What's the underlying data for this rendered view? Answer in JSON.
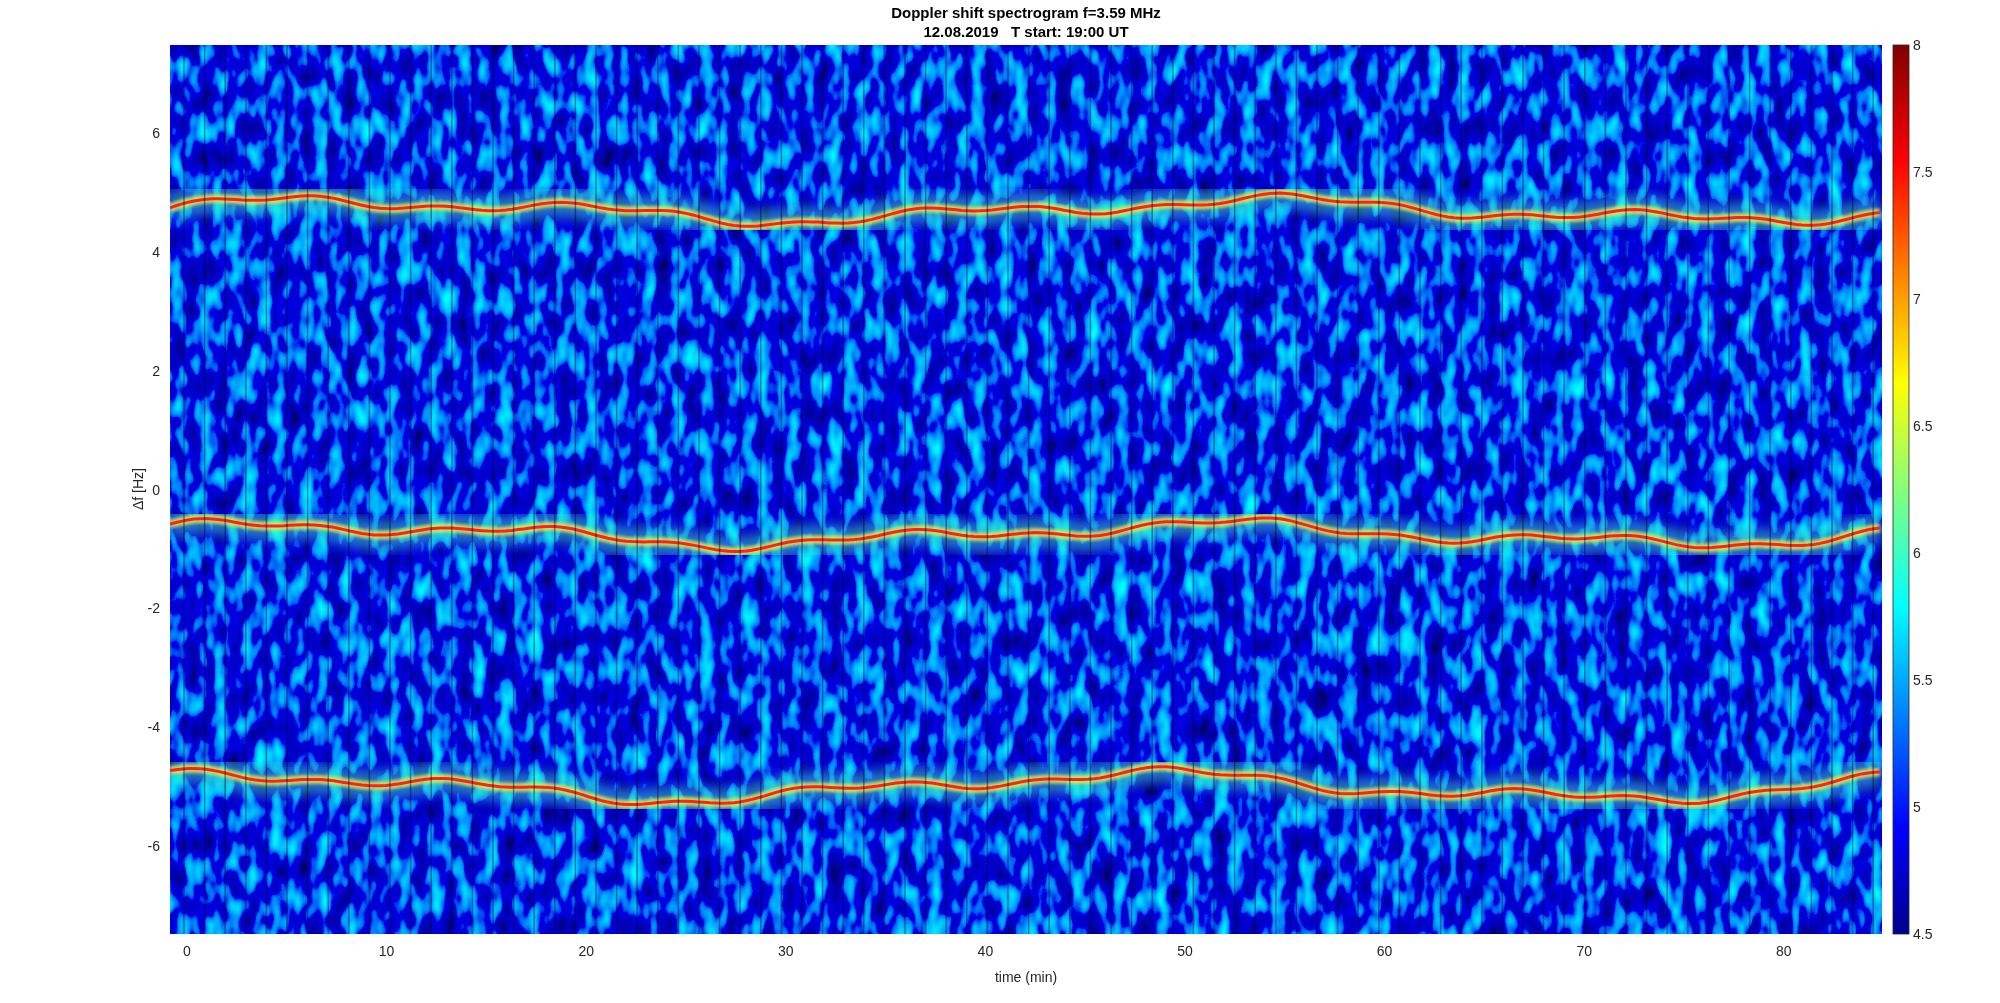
{
  "figure": {
    "title": "Doppler shift spectrogram f=3.59 MHz",
    "subtitle": "12.08.2019   T start: 19:00 UT",
    "xlabel": "time (min)",
    "ylabel": "Δf [Hz]",
    "xticks": [
      "0",
      "10",
      "20",
      "30",
      "40",
      "50",
      "60",
      "70",
      "80"
    ],
    "yticks": [
      "6",
      "4",
      "2",
      "0",
      "-2",
      "-4",
      "-6"
    ],
    "colorbar": {
      "ticks": [
        "8",
        "7.5",
        "7",
        "6.5",
        "6",
        "5.5",
        "5",
        "4.5"
      ]
    }
  }
}
